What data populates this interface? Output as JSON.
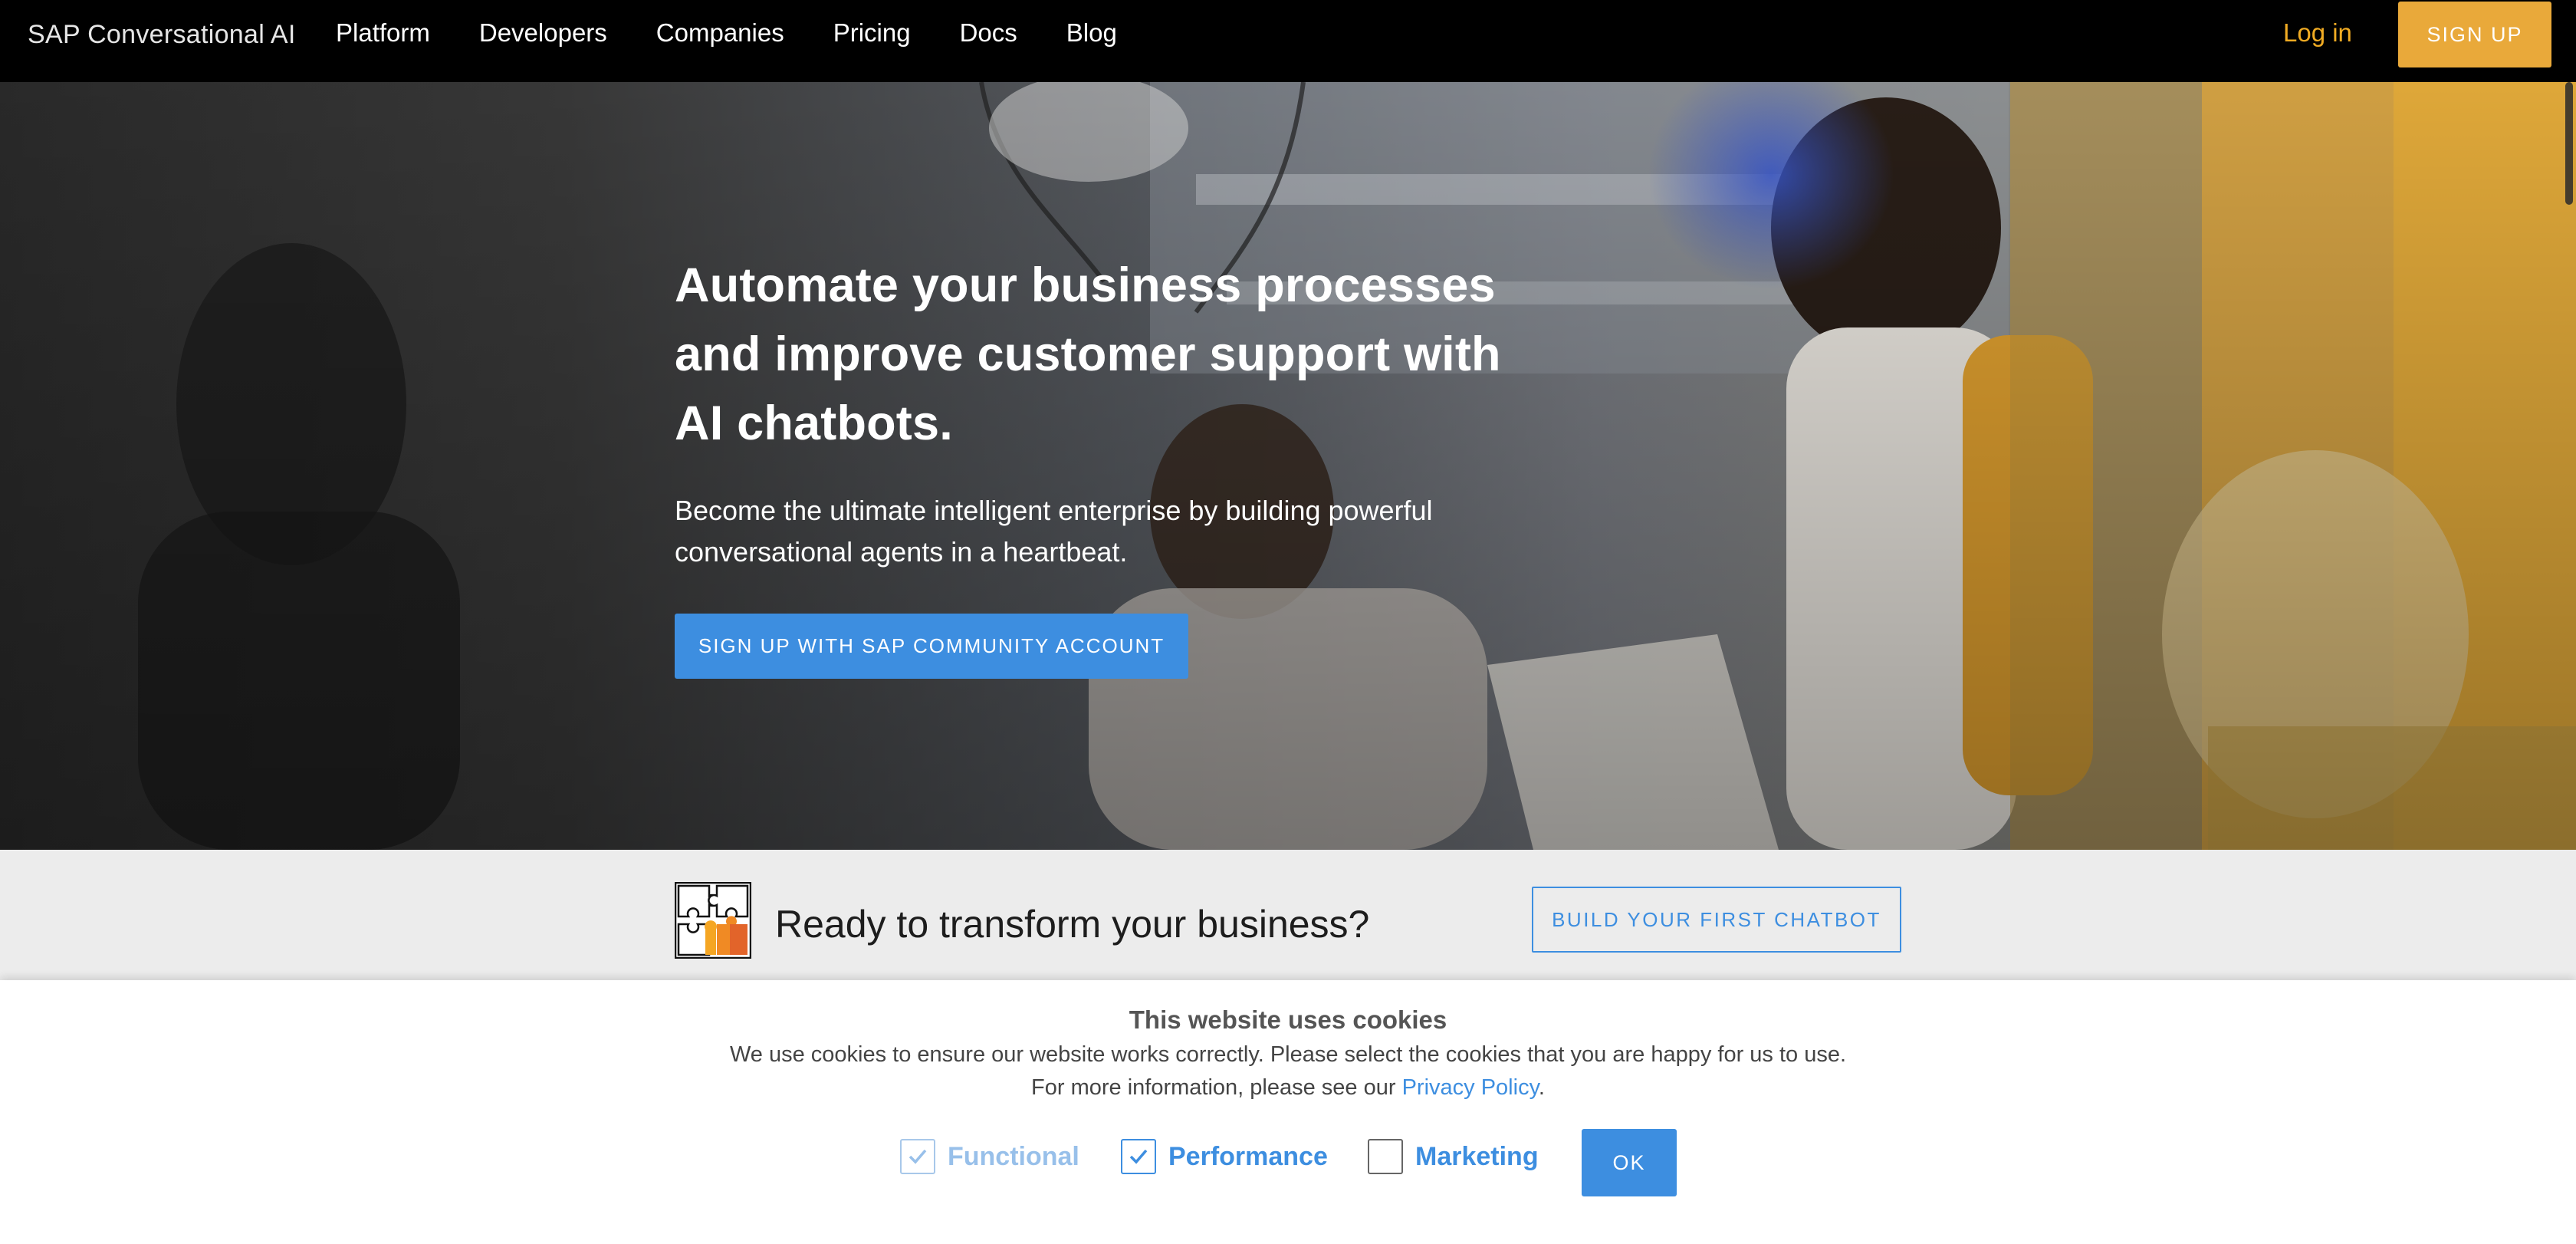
{
  "nav": {
    "brand": "SAP Conversational AI",
    "links": [
      "Platform",
      "Developers",
      "Companies",
      "Pricing",
      "Docs",
      "Blog"
    ],
    "login": "Log in",
    "signup": "SIGN UP"
  },
  "hero": {
    "title": "Automate your business processes and improve customer support with AI chatbots.",
    "subtitle": "Become the ultimate intelligent enterprise by building powerful conversational agents in a heartbeat.",
    "cta": "SIGN UP WITH SAP COMMUNITY ACCOUNT"
  },
  "strip": {
    "icon": "puzzle-icon",
    "heading": "Ready to transform your business?",
    "button": "BUILD YOUR FIRST CHATBOT"
  },
  "cookie": {
    "title": "This website uses cookies",
    "line1": "We use cookies to ensure our website works correctly. Please select the cookies that you are happy for us to use.",
    "line2_prefix": "For more information, please see our ",
    "line2_link": "Privacy Policy",
    "line2_suffix": ".",
    "options": [
      {
        "label": "Functional",
        "checked": true,
        "disabled": true
      },
      {
        "label": "Performance",
        "checked": true,
        "disabled": false
      },
      {
        "label": "Marketing",
        "checked": false,
        "disabled": false
      }
    ],
    "ok": "OK"
  },
  "colors": {
    "accent_blue": "#3d8ee0",
    "accent_orange": "#f0ab23",
    "nav_bg": "#000000",
    "hero_yellow": "#e8ac3a"
  }
}
